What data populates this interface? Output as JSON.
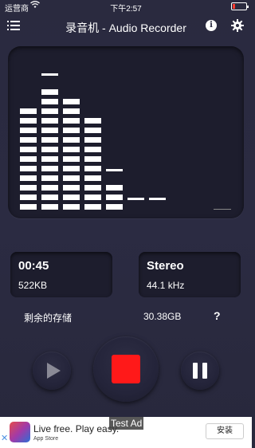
{
  "status_bar": {
    "carrier": "运营商",
    "time": "下午2:57",
    "battery_level": 0.15
  },
  "nav": {
    "title": "录音机 - Audio Recorder",
    "list_icon": "list-icon",
    "info_label": "i",
    "settings_icon": "gear-icon"
  },
  "visualizer": {
    "bar_levels": [
      11,
      13,
      12,
      10,
      3,
      0,
      0
    ],
    "peak_levels": [
      11,
      14,
      12,
      10,
      4,
      1,
      1
    ]
  },
  "recording": {
    "duration": "00:45",
    "size": "522KB",
    "channels": "Stereo",
    "sample_rate": "44.1 kHz"
  },
  "storage": {
    "label": "剩余的存储",
    "value": "30.38GB",
    "help": "?"
  },
  "controls": {
    "play_icon": "play-icon",
    "stop_icon": "stop-icon",
    "pause_icon": "pause-icon",
    "stop_color": "#ff1919"
  },
  "ad": {
    "headline": "Live free. Play easy.",
    "store": "App Store",
    "test_label": "Test Ad",
    "install_label": "安装"
  }
}
